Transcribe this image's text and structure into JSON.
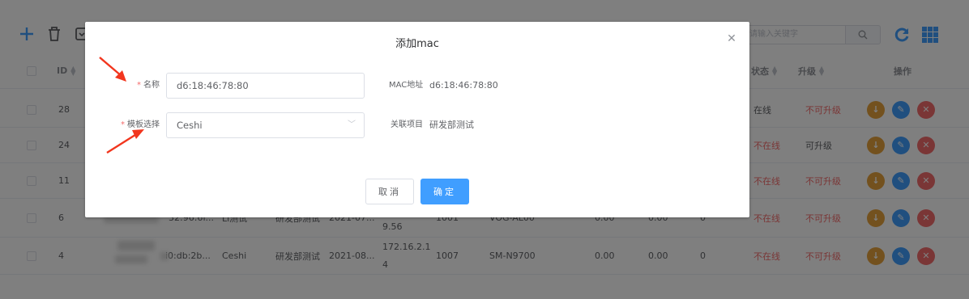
{
  "toolbar": {
    "search_placeholder": "请输入关键字"
  },
  "table": {
    "headers": {
      "id": "ID",
      "status": "状态",
      "upgrade": "升级",
      "ops": "操作"
    },
    "rows": [
      {
        "id": "28",
        "status": "在线",
        "upgrade": "不可升级",
        "status_red": false,
        "upgrade_red": true
      },
      {
        "id": "24",
        "status": "不在线",
        "upgrade": "可升级",
        "status_red": true,
        "upgrade_red": false
      },
      {
        "id": "11",
        "status": "不在线",
        "upgrade": "不可升级",
        "status_red": true,
        "upgrade_red": true
      },
      {
        "id": "6",
        "mac": "32:96:6f...",
        "name": "Li测试",
        "project": "研发部测试",
        "date": "2021-07...",
        "ip": "9.56",
        "v1": "1001",
        "model": "VOG-AL00",
        "n1": "0.00",
        "n2": "0.00",
        "n3": "0",
        "status": "不在线",
        "upgrade": "不可升级",
        "status_red": true,
        "upgrade_red": true
      },
      {
        "id": "4",
        "mac": "i0:db:2b...",
        "name": "Ceshi",
        "project": "研发部测试",
        "date": "2021-08...",
        "ip_line1": "172.16.2.1",
        "ip_line2": "4",
        "v1": "1007",
        "model": "SM-N9700",
        "n1": "0.00",
        "n2": "0.00",
        "n3": "0",
        "status": "不在线",
        "upgrade": "不可升级",
        "status_red": true,
        "upgrade_red": true
      }
    ]
  },
  "dialog": {
    "title": "添加mac",
    "close_icon": "close-icon",
    "name_label": "名称",
    "name_value": "d6:18:46:78:80",
    "template_label": "模板选择",
    "template_value": "Ceshi",
    "mac_label": "MAC地址",
    "mac_value": "d6:18:46:78:80",
    "project_label": "关联项目",
    "project_value": "研发部测试",
    "cancel_label": "取消",
    "ok_label": "确定"
  },
  "colors": {
    "primary": "#409eff",
    "danger": "#f56c6c",
    "warning": "#e6a23c",
    "annotation_arrow": "#f2361e"
  }
}
